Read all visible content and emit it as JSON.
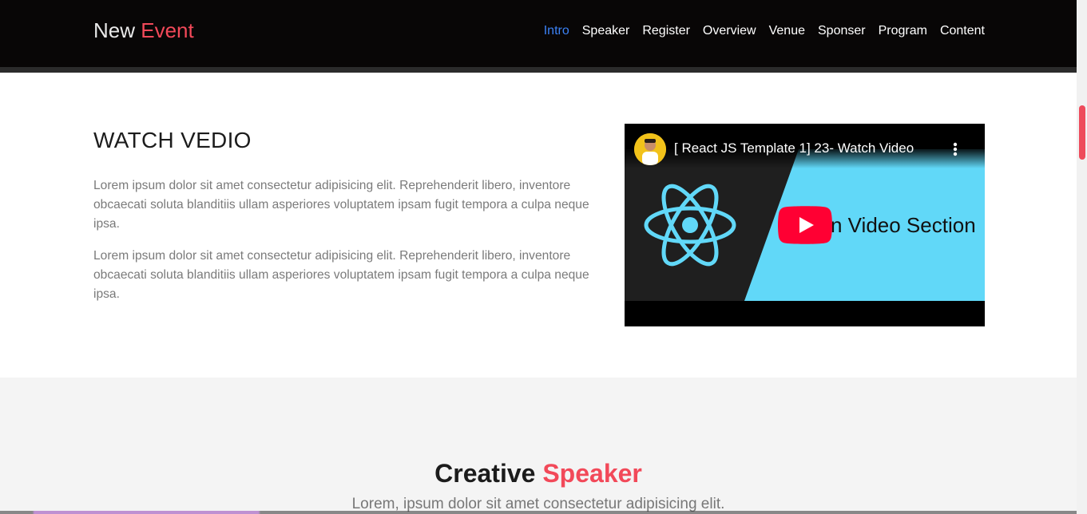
{
  "navbar": {
    "brand_main": "New",
    "brand_accent": "Event",
    "links": [
      "Intro",
      "Speaker",
      "Register",
      "Overview",
      "Venue",
      "Sponser",
      "Program",
      "Content"
    ],
    "active_index": 0,
    "colors": {
      "background": "#080606",
      "accent": "#f24959",
      "active": "#3b82f6"
    }
  },
  "watch": {
    "title": "WATCH VEDIO",
    "paragraphs": [
      "Lorem ipsum dolor sit amet consectetur adipisicing elit. Reprehenderit libero, inventore obcaecati soluta blanditiis ullam asperiores voluptatem ipsam fugit tempora a culpa neque ipsa.",
      "Lorem ipsum dolor sit amet consectetur adipisicing elit. Reprehenderit libero, inventore obcaecati soluta blanditiis ullam asperiores voluptatem ipsam fugit tempora a culpa neque ipsa."
    ],
    "video": {
      "title": "[ React JS Template 1] 23- Watch Video",
      "thumbnail_text": "n Video Section",
      "icons": [
        "channel-avatar",
        "more-options-icon",
        "react-logo-icon",
        "youtube-play-icon"
      ]
    }
  },
  "speaker": {
    "title_main": "Creative",
    "title_accent": "Speaker",
    "subtitle": "Lorem, ipsum dolor sit amet consectetur adipisicing elit."
  }
}
